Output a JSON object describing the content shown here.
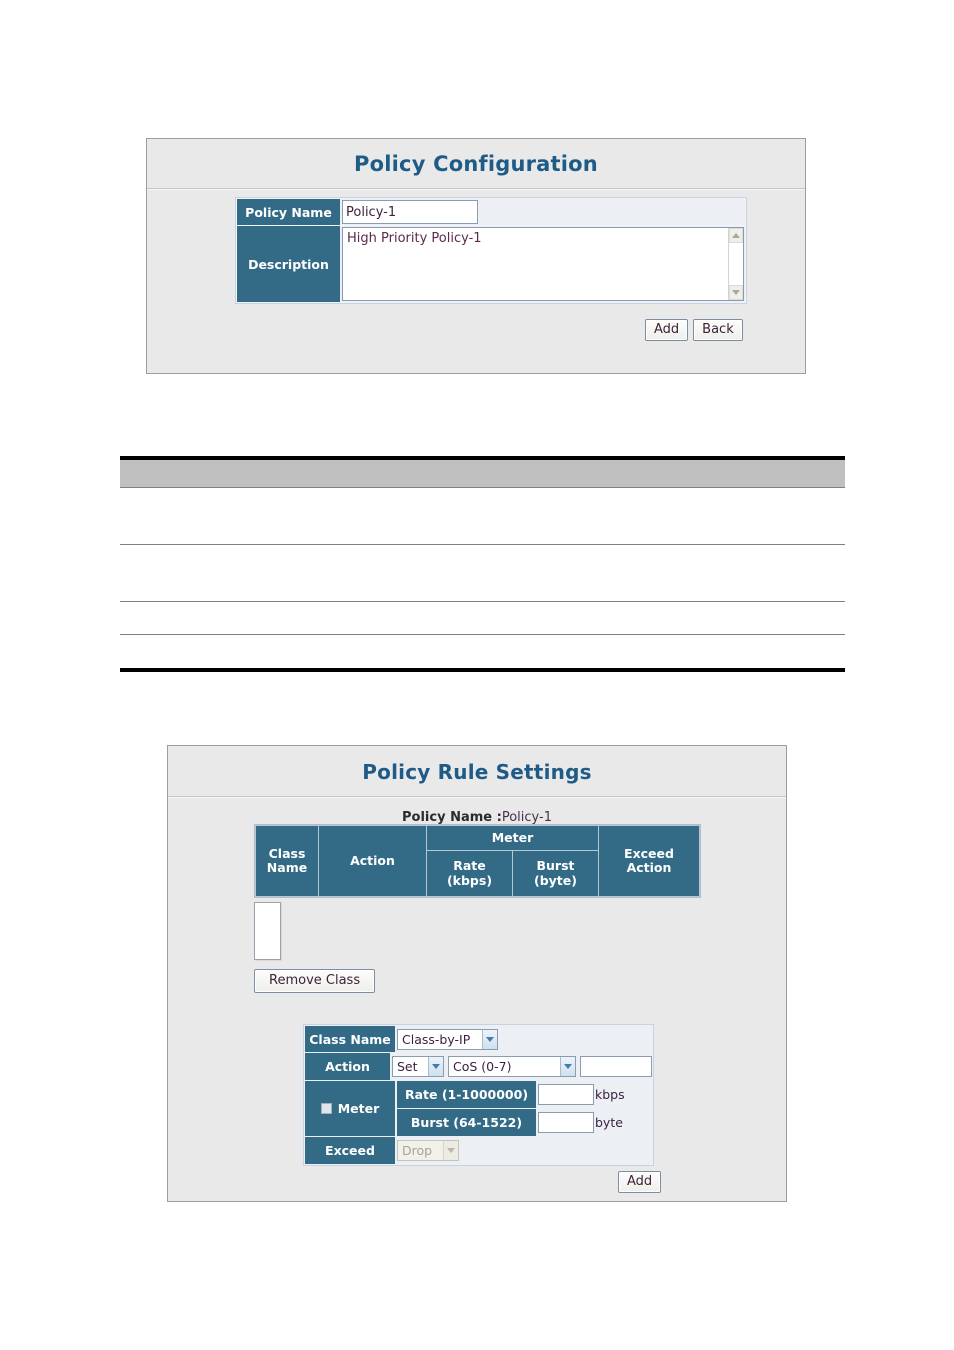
{
  "policy_configuration": {
    "title": "Policy Configuration",
    "fields": {
      "policy_name_label": "Policy Name",
      "policy_name_value": "Policy-1",
      "description_label": "Description",
      "description_value": "High Priority Policy-1"
    },
    "buttons": {
      "add": "Add",
      "back": "Back"
    },
    "scrollbar": {
      "up_icon": "chevron-up-icon",
      "down_icon": "chevron-down-icon"
    }
  },
  "doc_table": {
    "rows": 4
  },
  "policy_rule_settings": {
    "title": "Policy Rule Settings",
    "policy_name_label": "Policy Name :",
    "policy_name_value": "Policy-1",
    "table_headers": {
      "class_name": "Class\nName",
      "class_name_line1": "Class",
      "class_name_line2": "Name",
      "action": "Action",
      "meter": "Meter",
      "rate_line1": "Rate",
      "rate_line2": "(kbps)",
      "burst_line1": "Burst",
      "burst_line2": "(byte)",
      "exceed_line1": "Exceed",
      "exceed_line2": "Action"
    },
    "class_list": [],
    "remove_class_button": "Remove Class",
    "form": {
      "class_name_label": "Class Name",
      "class_name_value": "Class-by-IP",
      "action_label": "Action",
      "action_mode_value": "Set",
      "action_type_value": "CoS (0-7)",
      "action_input_value": "",
      "meter_label": "Meter",
      "meter_checked": false,
      "rate_label": "Rate (1-1000000)",
      "rate_value": "",
      "rate_unit": "kbps",
      "burst_label": "Burst (64-1522)",
      "burst_value": "",
      "burst_unit": "byte",
      "exceed_label": "Exceed",
      "exceed_value": "Drop",
      "exceed_disabled": true
    },
    "add_button": "Add"
  },
  "colors": {
    "label_blue": "#336b87",
    "title_blue": "#1f5b87",
    "panel_bg": "#e9e9e9",
    "doc_header_gray": "#c0c0c0"
  }
}
